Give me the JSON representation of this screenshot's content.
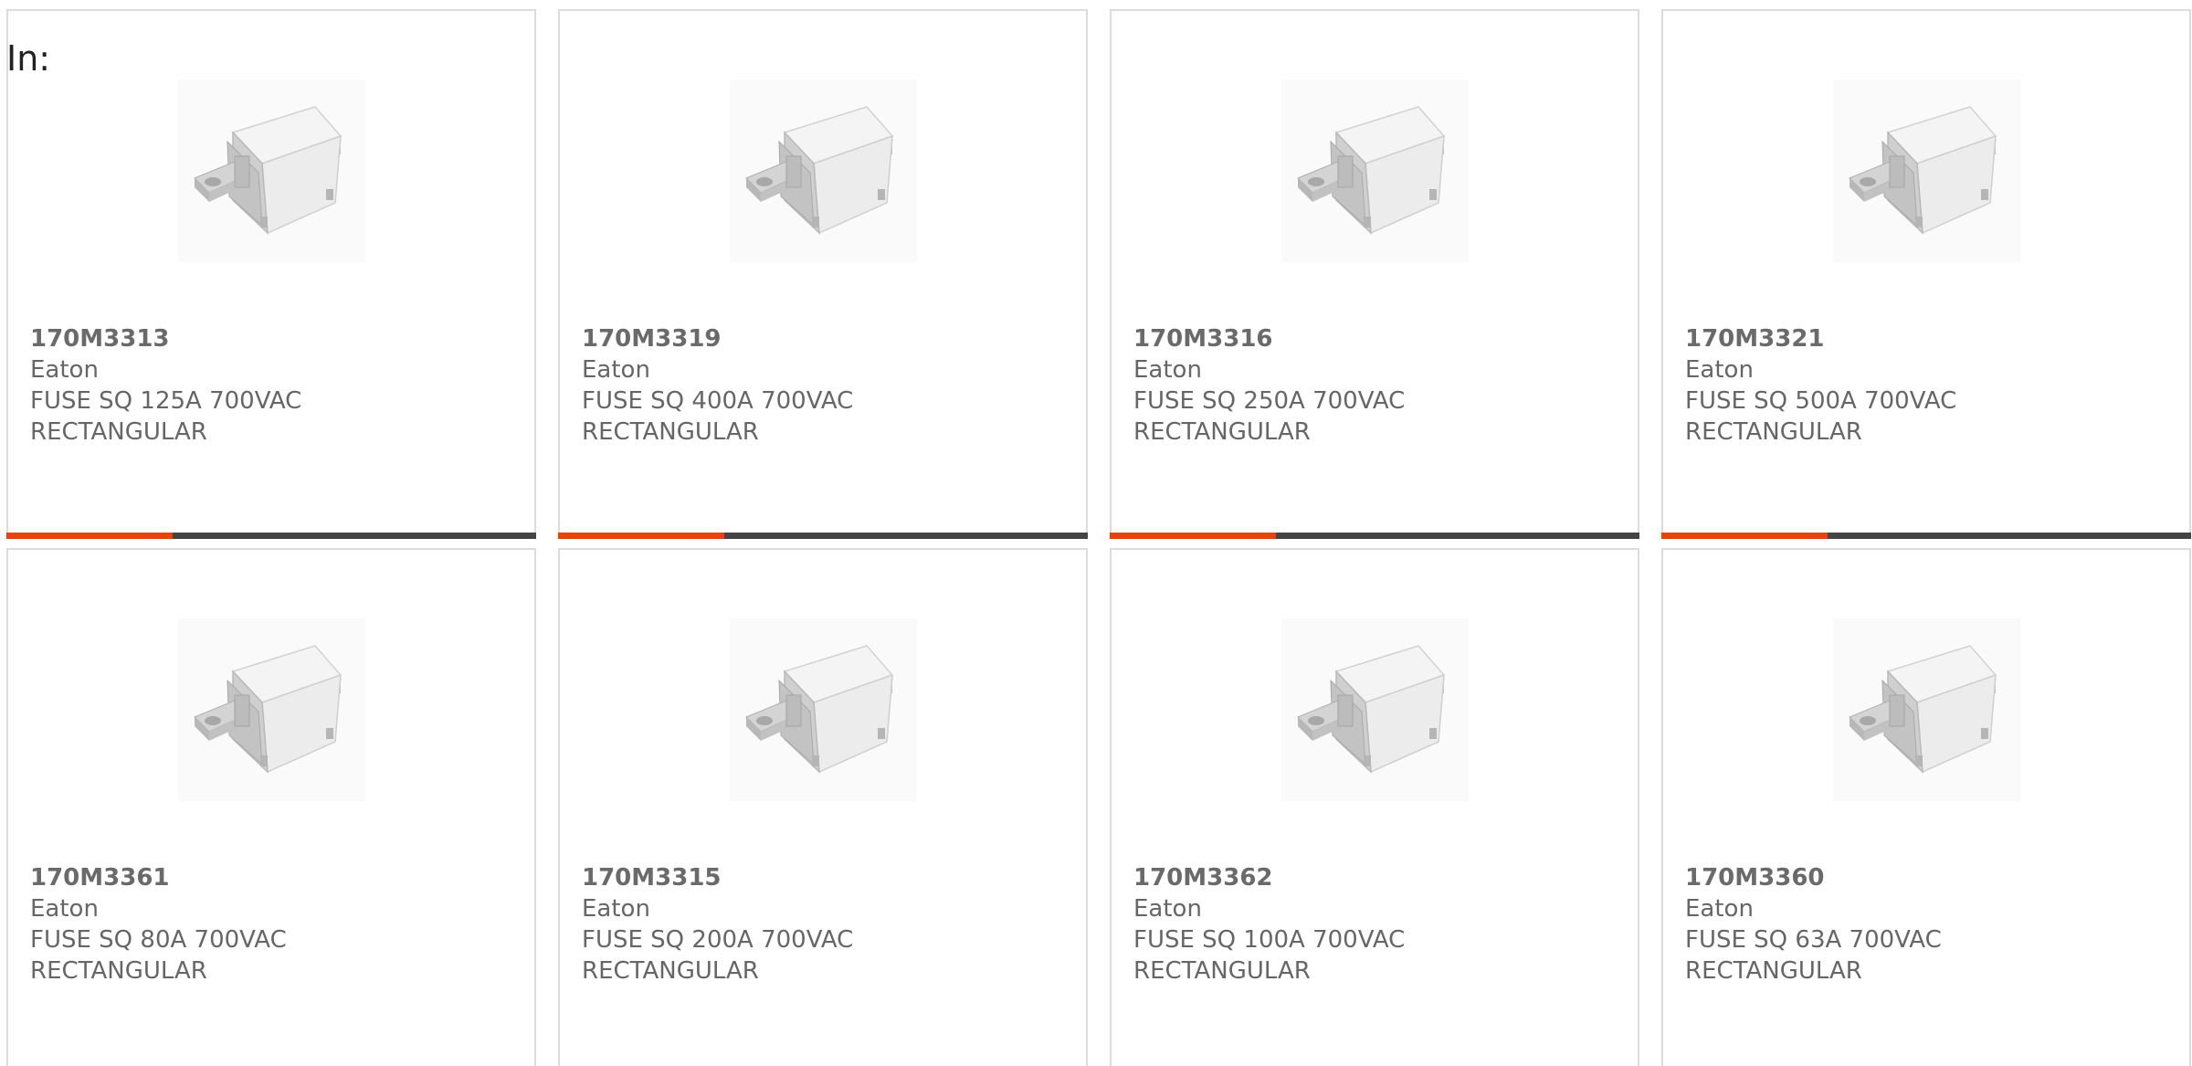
{
  "header": {
    "in_label": "In:"
  },
  "colors": {
    "accent": "#e8430f",
    "bar": "#444444"
  },
  "products": [
    {
      "part": "170M3313",
      "manufacturer": "Eaton",
      "desc_line1": "FUSE SQ 125A 700VAC",
      "desc_line2": "RECTANGULAR",
      "image": "fuse-product-image"
    },
    {
      "part": "170M3319",
      "manufacturer": "Eaton",
      "desc_line1": "FUSE SQ 400A 700VAC",
      "desc_line2": "RECTANGULAR",
      "image": "fuse-product-image"
    },
    {
      "part": "170M3316",
      "manufacturer": "Eaton",
      "desc_line1": "FUSE SQ 250A 700VAC",
      "desc_line2": "RECTANGULAR",
      "image": "fuse-product-image"
    },
    {
      "part": "170M3321",
      "manufacturer": "Eaton",
      "desc_line1": "FUSE SQ 500A 700VAC",
      "desc_line2": "RECTANGULAR",
      "image": "fuse-product-image"
    },
    {
      "part": "170M3361",
      "manufacturer": "Eaton",
      "desc_line1": "FUSE SQ 80A 700VAC",
      "desc_line2": "RECTANGULAR",
      "image": "fuse-product-image"
    },
    {
      "part": "170M3315",
      "manufacturer": "Eaton",
      "desc_line1": "FUSE SQ 200A 700VAC",
      "desc_line2": "RECTANGULAR",
      "image": "fuse-product-image"
    },
    {
      "part": "170M3362",
      "manufacturer": "Eaton",
      "desc_line1": "FUSE SQ 100A 700VAC",
      "desc_line2": "RECTANGULAR",
      "image": "fuse-product-image"
    },
    {
      "part": "170M3360",
      "manufacturer": "Eaton",
      "desc_line1": "FUSE SQ 63A 700VAC",
      "desc_line2": "RECTANGULAR",
      "image": "fuse-product-image"
    }
  ]
}
